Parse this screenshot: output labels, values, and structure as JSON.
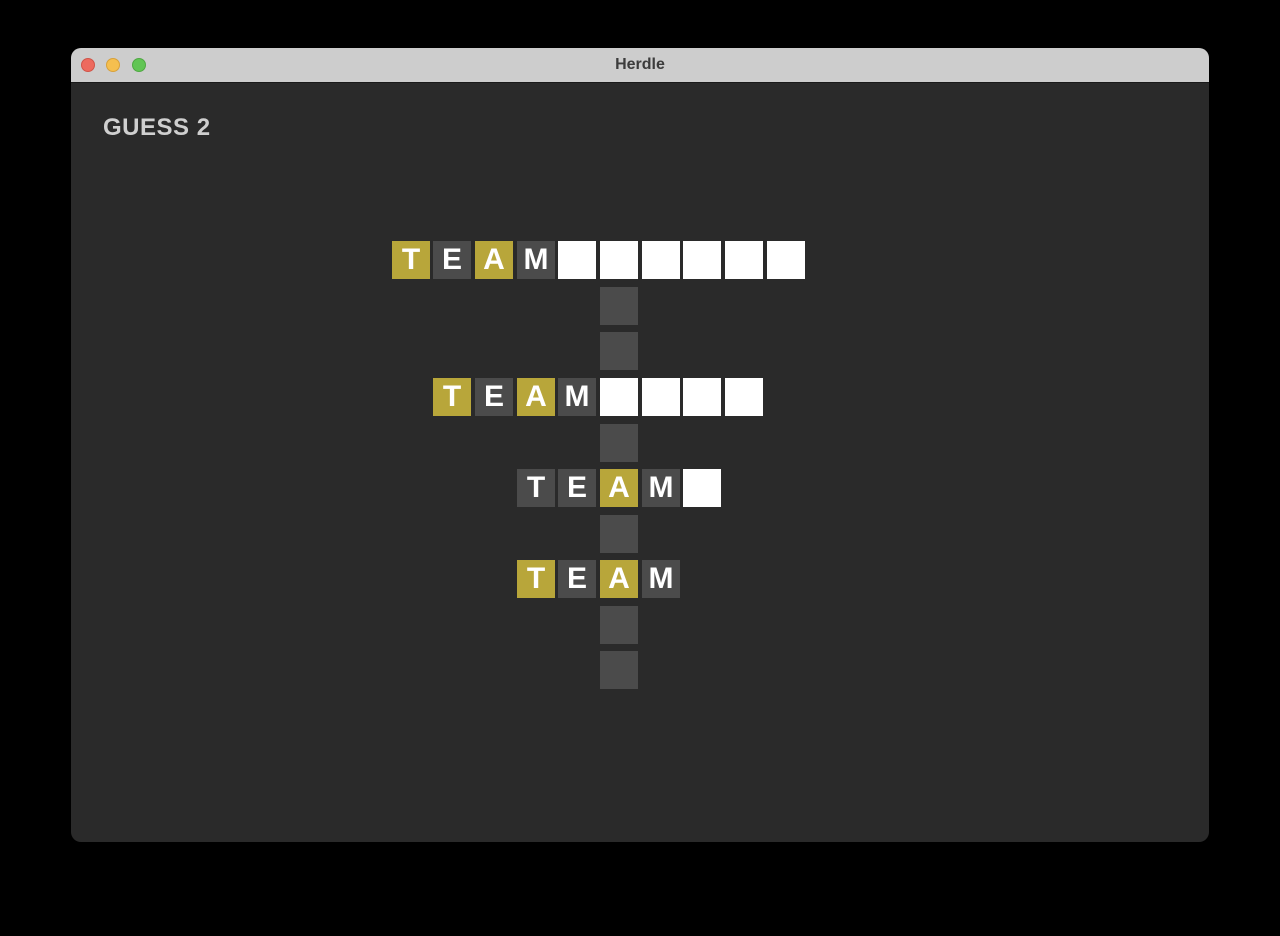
{
  "window": {
    "title": "Herdle"
  },
  "status": {
    "guess_label": "GUESS 2"
  },
  "colors": {
    "present": "#b8a63a",
    "absent": "#4b4b4b",
    "empty": "#ffffff",
    "connector": "#4b4b4b",
    "background": "#2a2a2a"
  },
  "rows": [
    {
      "tiles": [
        {
          "letter": "T",
          "state": "present"
        },
        {
          "letter": "E",
          "state": "absent"
        },
        {
          "letter": "A",
          "state": "present"
        },
        {
          "letter": "M",
          "state": "absent"
        },
        {
          "letter": "",
          "state": "empty"
        },
        {
          "letter": "",
          "state": "empty"
        },
        {
          "letter": "",
          "state": "empty"
        },
        {
          "letter": "",
          "state": "empty"
        },
        {
          "letter": "",
          "state": "empty"
        },
        {
          "letter": "",
          "state": "empty"
        }
      ]
    },
    {
      "tiles": [
        {
          "letter": "T",
          "state": "present"
        },
        {
          "letter": "E",
          "state": "absent"
        },
        {
          "letter": "A",
          "state": "present"
        },
        {
          "letter": "M",
          "state": "absent"
        },
        {
          "letter": "",
          "state": "empty"
        },
        {
          "letter": "",
          "state": "empty"
        },
        {
          "letter": "",
          "state": "empty"
        },
        {
          "letter": "",
          "state": "empty"
        }
      ]
    },
    {
      "tiles": [
        {
          "letter": "T",
          "state": "absent"
        },
        {
          "letter": "E",
          "state": "absent"
        },
        {
          "letter": "A",
          "state": "present"
        },
        {
          "letter": "M",
          "state": "absent"
        },
        {
          "letter": "",
          "state": "empty"
        }
      ]
    },
    {
      "tiles": [
        {
          "letter": "T",
          "state": "present"
        },
        {
          "letter": "E",
          "state": "absent"
        },
        {
          "letter": "A",
          "state": "present"
        },
        {
          "letter": "M",
          "state": "absent"
        }
      ]
    }
  ]
}
